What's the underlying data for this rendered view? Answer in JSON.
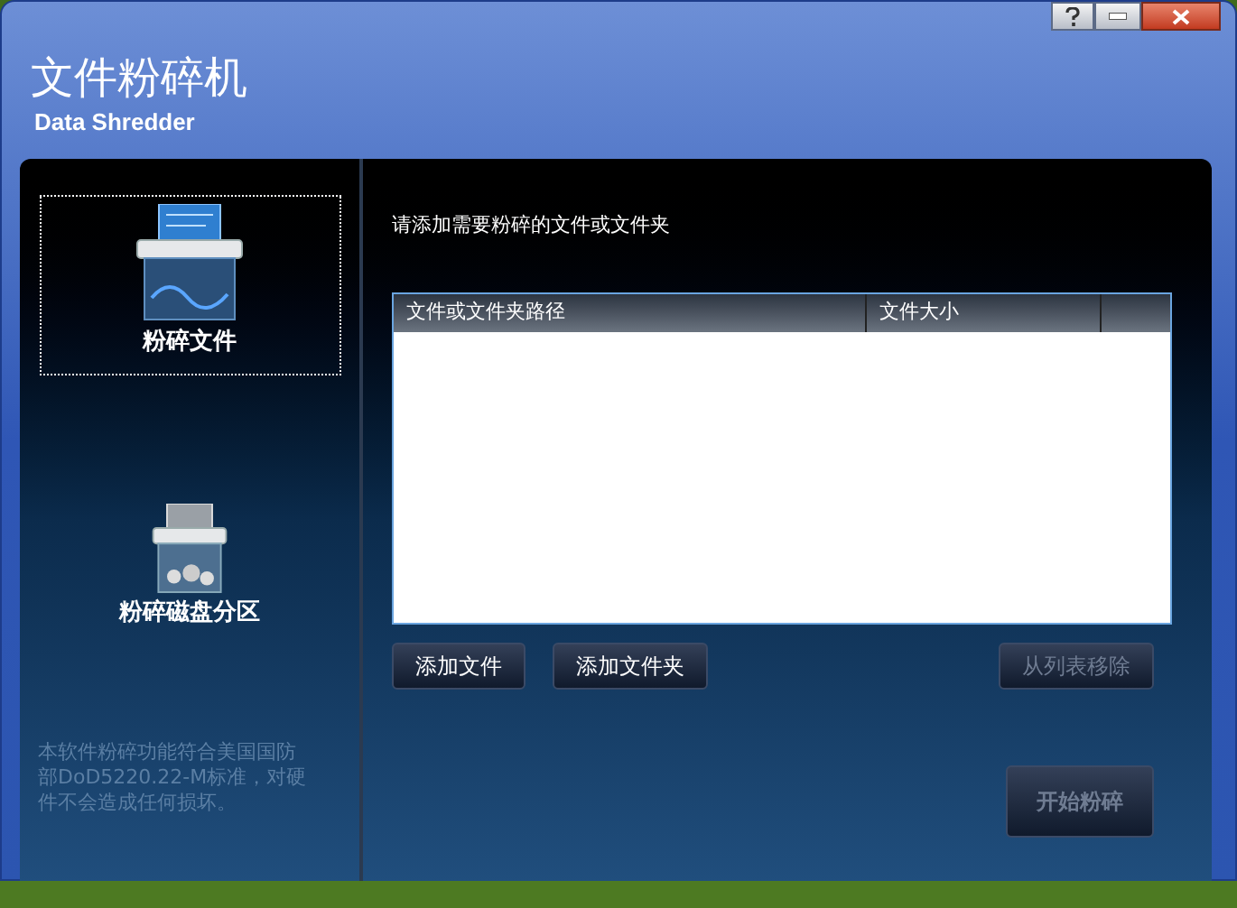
{
  "window": {
    "title": "文件粉碎机",
    "subtitle": "Data Shredder"
  },
  "sidebar": {
    "items": [
      {
        "label": "粉碎文件",
        "kind": "file",
        "selected": true
      },
      {
        "label": "粉碎磁盘分区",
        "kind": "disk",
        "selected": false
      }
    ],
    "notice": "本软件粉碎功能符合美国国防部DoD5220.22-M标准，对硬件不会造成任何损坏。"
  },
  "prompt": "请添加需要粉碎的文件或文件夹",
  "table": {
    "columns": [
      "文件或文件夹路径",
      "文件大小"
    ]
  },
  "buttons": [
    {
      "label": "添加文件",
      "disabled": false
    },
    {
      "label": "添加文件夹",
      "disabled": false
    },
    {
      "label": "从列表移除",
      "disabled": true
    }
  ],
  "start_button": {
    "label": "开始粉碎",
    "disabled": true
  }
}
